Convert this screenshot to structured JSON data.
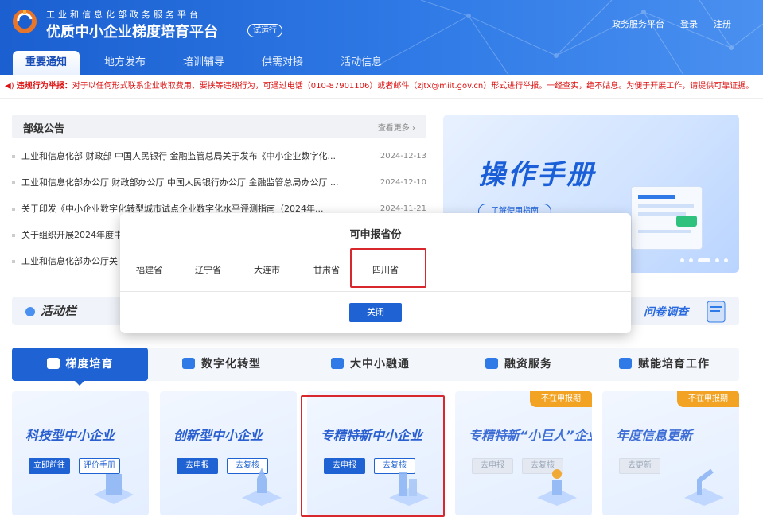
{
  "header": {
    "subtitle": "工业和信息化部政务服务平台",
    "brand": "优质中小企业梯度培育平台",
    "trial_badge": "试运行",
    "links": [
      "政务服务平台",
      "登录",
      "注册"
    ],
    "tabs": [
      "重要通知",
      "地方发布",
      "培训辅导",
      "供需对接",
      "活动信息"
    ]
  },
  "notice": {
    "label": "违规行为举报：",
    "text": "对于以任何形式联系企业收取费用、要挟等违规行为，可通过电话（010-87901106）或者邮件（zjtx@miit.gov.cn）形式进行举报。一经查实，绝不姑息。为便于开展工作，请提供可靠证据。"
  },
  "announcements": {
    "title": "部级公告",
    "more": "查看更多",
    "items": [
      {
        "title": "工业和信息化部 财政部 中国人民银行 金融监管总局关于发布《中小企业数字化...",
        "date": "2024-12-13"
      },
      {
        "title": "工业和信息化部办公厅 财政部办公厅 中国人民银行办公厅 金融监管总局办公厅 ...",
        "date": "2024-12-10"
      },
      {
        "title": "关于印发《中小企业数字化转型城市试点企业数字化水平评测指南（2024年...",
        "date": "2024-11-21"
      },
      {
        "title": "关于组织开展2024年度中",
        "date": ""
      },
      {
        "title": "工业和信息化部办公厅关",
        "date": ""
      }
    ]
  },
  "banner": {
    "title": "操作手册",
    "button": "了解使用指南"
  },
  "activity": {
    "title": "活动栏",
    "survey": "问卷调查"
  },
  "categories": [
    "梯度培育",
    "数字化转型",
    "大中小融通",
    "融资服务",
    "赋能培育工作"
  ],
  "cards": [
    {
      "title": "科技型中小企业",
      "btn1": "立即前往",
      "btn2": "评价手册",
      "tag": ""
    },
    {
      "title": "创新型中小企业",
      "btn1": "去申报",
      "btn2": "去复核",
      "tag": ""
    },
    {
      "title": "专精特新中小企业",
      "btn1": "去申报",
      "btn2": "去复核",
      "tag": ""
    },
    {
      "title": "专精特新“小巨人”企业",
      "btn1": "去申报",
      "btn2": "去复核",
      "tag": "不在申报期"
    },
    {
      "title": "年度信息更新",
      "btn1": "去更新",
      "btn2": "",
      "tag": "不在申报期"
    }
  ],
  "modal": {
    "title": "可申报省份",
    "provinces": [
      "福建省",
      "辽宁省",
      "大连市",
      "甘肃省",
      "四川省"
    ],
    "close": "关闭"
  },
  "colors": {
    "primary": "#1f62d3",
    "alert": "#d9272e",
    "tag": "#f2a323"
  }
}
